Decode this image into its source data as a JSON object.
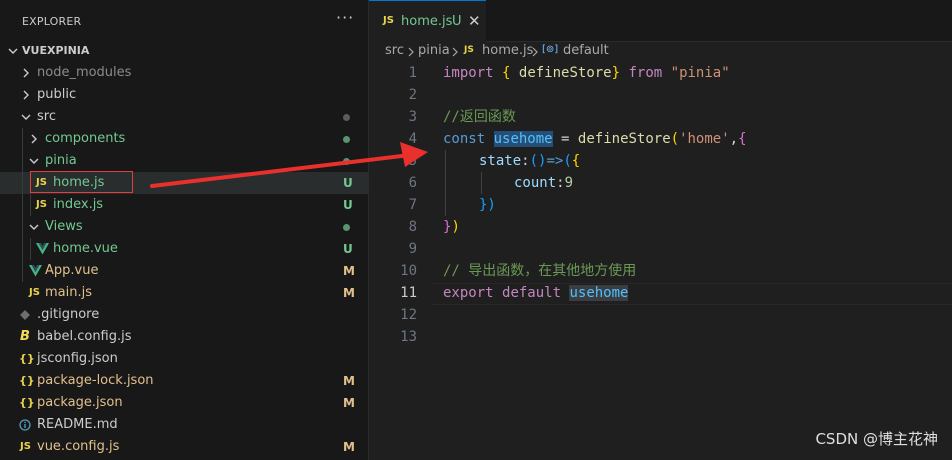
{
  "explorer": {
    "title": "EXPLORER",
    "more_icon": "···",
    "root": "VUEXPINIA",
    "items": [
      {
        "label": "node_modules",
        "icon": "chevron-right",
        "color": "#8b8b8b",
        "deco": ""
      },
      {
        "label": "public",
        "icon": "chevron-right",
        "color": "#cccccc",
        "deco": ""
      },
      {
        "label": "src",
        "icon": "chevron-down",
        "color": "#cccccc",
        "deco": "dot-gray"
      },
      {
        "label": "components",
        "icon": "chevron-right",
        "color": "#73c991",
        "deco": "dot-green"
      },
      {
        "label": "pinia",
        "icon": "chevron-down",
        "color": "#73c991",
        "deco": "dot-green"
      },
      {
        "label": "home.js",
        "icon": "JS",
        "color": "#73c991",
        "deco": "U"
      },
      {
        "label": "index.js",
        "icon": "JS",
        "color": "#73c991",
        "deco": "U"
      },
      {
        "label": "Views",
        "icon": "chevron-down",
        "color": "#73c991",
        "deco": "dot-green"
      },
      {
        "label": "home.vue",
        "icon": "vue",
        "color": "#73c991",
        "deco": "U"
      },
      {
        "label": "App.vue",
        "icon": "vue",
        "color": "#e2c08d",
        "deco": "M"
      },
      {
        "label": "main.js",
        "icon": "JS",
        "color": "#e2c08d",
        "deco": "M"
      },
      {
        "label": ".gitignore",
        "icon": "git",
        "color": "#cccccc",
        "deco": ""
      },
      {
        "label": "babel.config.js",
        "icon": "babel",
        "color": "#cccccc",
        "deco": ""
      },
      {
        "label": "jsconfig.json",
        "icon": "{}",
        "color": "#cccccc",
        "deco": ""
      },
      {
        "label": "package-lock.json",
        "icon": "{}",
        "color": "#e2c08d",
        "deco": "M"
      },
      {
        "label": "package.json",
        "icon": "{}",
        "color": "#e2c08d",
        "deco": "M"
      },
      {
        "label": "README.md",
        "icon": "info",
        "color": "#cccccc",
        "deco": ""
      },
      {
        "label": "vue.config.js",
        "icon": "JS",
        "color": "#e2c08d",
        "deco": "M"
      }
    ]
  },
  "tab": {
    "icon": "JS",
    "name": "home.js",
    "status": "U",
    "close": "✕"
  },
  "breadcrumb": {
    "parts": [
      "src",
      "pinia",
      "home.js",
      "default"
    ],
    "js_icon": "JS",
    "symbol_icon": "[⊚]"
  },
  "code": {
    "line_numbers": [
      "1",
      "2",
      "3",
      "4",
      "5",
      "6",
      "7",
      "8",
      "9",
      "10",
      "11",
      "12",
      "13"
    ],
    "active_line": "11",
    "l1": {
      "kw": "import",
      "b1": "{",
      "name": "defineStore",
      "b2": "}",
      "from": "from",
      "str": "\"pinia\""
    },
    "l3": "//返回函数",
    "l4": {
      "kw": "const",
      "var": "usehome",
      "eq": "=",
      "fn": "defineStore",
      "p1": "(",
      "str": "'home'",
      "comma": ",",
      "b1": "{"
    },
    "l5": {
      "prop": "state",
      "colon": ":",
      "p1": "()",
      "arrow": "=>",
      "p2": "(",
      "b1": "{"
    },
    "l6": {
      "prop": "count",
      "colon": ":",
      "num": "9"
    },
    "l7": {
      "b1": "})"
    },
    "l8": {
      "b1": "}",
      "p1": ")"
    },
    "l10": "// 导出函数，在其他地方使用",
    "l11": {
      "kw1": "export",
      "kw2": "default",
      "var": "usehome"
    }
  },
  "watermark": "CSDN @博主花神"
}
